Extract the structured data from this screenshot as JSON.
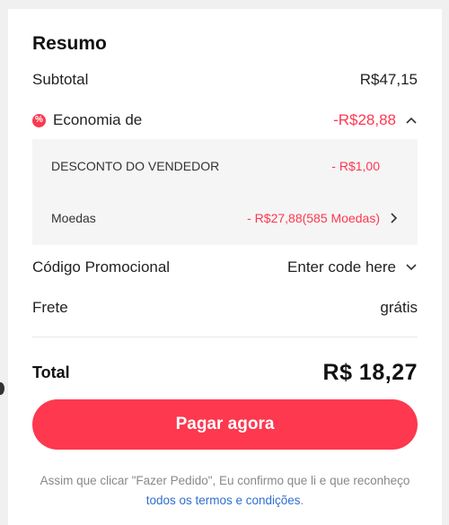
{
  "summary": {
    "title": "Resumo",
    "subtotal": {
      "label": "Subtotal",
      "value": "R$47,15"
    },
    "savings": {
      "icon": "percent-badge-icon",
      "icon_glyph": "%",
      "label": "Economia de",
      "value": "-R$28,88",
      "expanded": true,
      "items": [
        {
          "label": "DESCONTO DO VENDEDOR",
          "value": "- R$1,00"
        },
        {
          "label": "Moedas",
          "value": "- R$27,88(585 Moedas)"
        }
      ]
    },
    "promo": {
      "label": "Código Promocional",
      "value": "Enter code here"
    },
    "shipping": {
      "label": "Frete",
      "value": "grátis"
    },
    "total": {
      "label": "Total",
      "value": "R$ 18,27"
    },
    "pay_button": "Pagar agora",
    "terms": {
      "text": "Assim que clicar \"Fazer Pedido\", Eu confirmo que li e que reconheço",
      "link": "todos os termos e condições",
      "suffix": "."
    }
  },
  "colors": {
    "accent": "#fd384f",
    "link": "#2e6fd0"
  }
}
